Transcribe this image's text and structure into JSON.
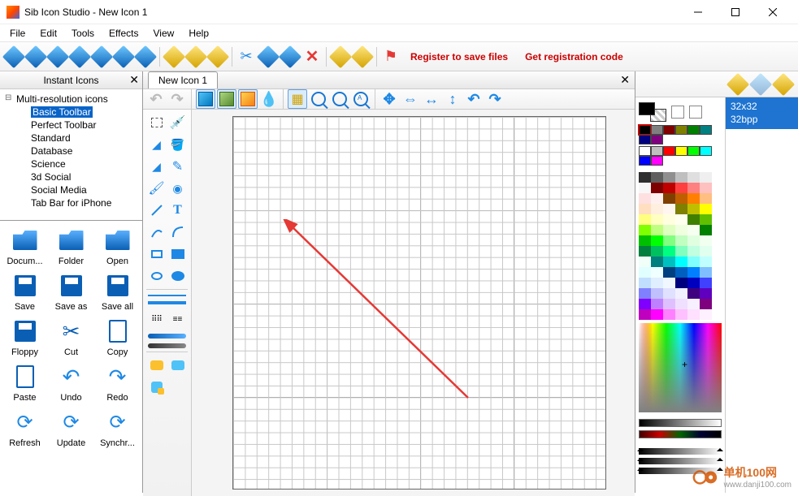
{
  "window": {
    "title": "Sib Icon Studio - New Icon 1"
  },
  "menu": {
    "items": [
      "File",
      "Edit",
      "Tools",
      "Effects",
      "View",
      "Help"
    ]
  },
  "toolbar": {
    "register_text": "Register to save files",
    "get_code_text": "Get registration code"
  },
  "left_panel": {
    "header": "Instant Icons",
    "tree_root": "Multi-resolution icons",
    "tree_items": [
      "Basic Toolbar",
      "Perfect Toolbar",
      "Standard",
      "Database",
      "Science",
      "3d Social",
      "Social Media",
      "Tab Bar for iPhone"
    ],
    "tree_selected_index": 0,
    "actions": [
      {
        "label": "Docum...",
        "icon": "folder"
      },
      {
        "label": "Folder",
        "icon": "folder"
      },
      {
        "label": "Open",
        "icon": "folder-open"
      },
      {
        "label": "Save",
        "icon": "floppy"
      },
      {
        "label": "Save as",
        "icon": "floppy-pencil"
      },
      {
        "label": "Save all",
        "icon": "floppy-multi"
      },
      {
        "label": "Floppy",
        "icon": "floppy"
      },
      {
        "label": "Cut",
        "icon": "scissors"
      },
      {
        "label": "Copy",
        "icon": "doc"
      },
      {
        "label": "Paste",
        "icon": "clipboard"
      },
      {
        "label": "Undo",
        "icon": "undo"
      },
      {
        "label": "Redo",
        "icon": "redo"
      },
      {
        "label": "Refresh",
        "icon": "refresh"
      },
      {
        "label": "Update",
        "icon": "update"
      },
      {
        "label": "Synchr...",
        "icon": "sync"
      }
    ]
  },
  "document": {
    "tab_label": "New Icon 1"
  },
  "right_panel": {
    "format_size": "32x32",
    "format_depth": "32bpp",
    "named_colors_row1": [
      "#000000",
      "#808080",
      "#800000",
      "#808000",
      "#008000",
      "#008080",
      "#000080",
      "#800080"
    ],
    "named_colors_row2": [
      "#ffffff",
      "#c0c0c0",
      "#ff0000",
      "#ffff00",
      "#00ff00",
      "#00ffff",
      "#0000ff",
      "#ff00ff"
    ],
    "palette": [
      "#2f2f2f",
      "#5f5f5f",
      "#8f8f8f",
      "#bfbfbf",
      "#dfdfdf",
      "#efefef",
      "#f7f7f7",
      "#7f0000",
      "#bf0000",
      "#ff4040",
      "#ff8080",
      "#ffc0c0",
      "#ffe0e0",
      "#fff0f0",
      "#7f3f00",
      "#bf5f00",
      "#ff8000",
      "#ffbf80",
      "#ffdfc0",
      "#ffefdf",
      "#fff7ef",
      "#7f7f00",
      "#bfbf00",
      "#ffff00",
      "#ffff80",
      "#ffffc0",
      "#ffffe0",
      "#fffff0",
      "#3f7f00",
      "#5fbf00",
      "#80ff00",
      "#bfff80",
      "#dfffc0",
      "#efffe0",
      "#f7fff0",
      "#007f00",
      "#00bf00",
      "#00ff00",
      "#80ff80",
      "#c0ffc0",
      "#e0ffe0",
      "#f0fff0",
      "#007f3f",
      "#00bf5f",
      "#00ff80",
      "#80ffbf",
      "#c0ffdf",
      "#e0ffef",
      "#f0fff7",
      "#007f7f",
      "#00bfbf",
      "#00ffff",
      "#80ffff",
      "#c0ffff",
      "#e0ffff",
      "#f0ffff",
      "#003f7f",
      "#005fbf",
      "#0080ff",
      "#80bfff",
      "#c0dfff",
      "#e0efff",
      "#f0f7ff",
      "#00007f",
      "#0000bf",
      "#4040ff",
      "#8080ff",
      "#c0c0ff",
      "#e0e0ff",
      "#f0f0ff",
      "#3f007f",
      "#5f00bf",
      "#8000ff",
      "#bf80ff",
      "#dfc0ff",
      "#efe0ff",
      "#f7f0ff",
      "#7f007f",
      "#bf00bf",
      "#ff00ff",
      "#ff80ff",
      "#ffc0ff",
      "#ffe0ff",
      "#fff0ff"
    ]
  },
  "watermark": {
    "line1": "单机100网",
    "line2": "www.danji100.com"
  }
}
